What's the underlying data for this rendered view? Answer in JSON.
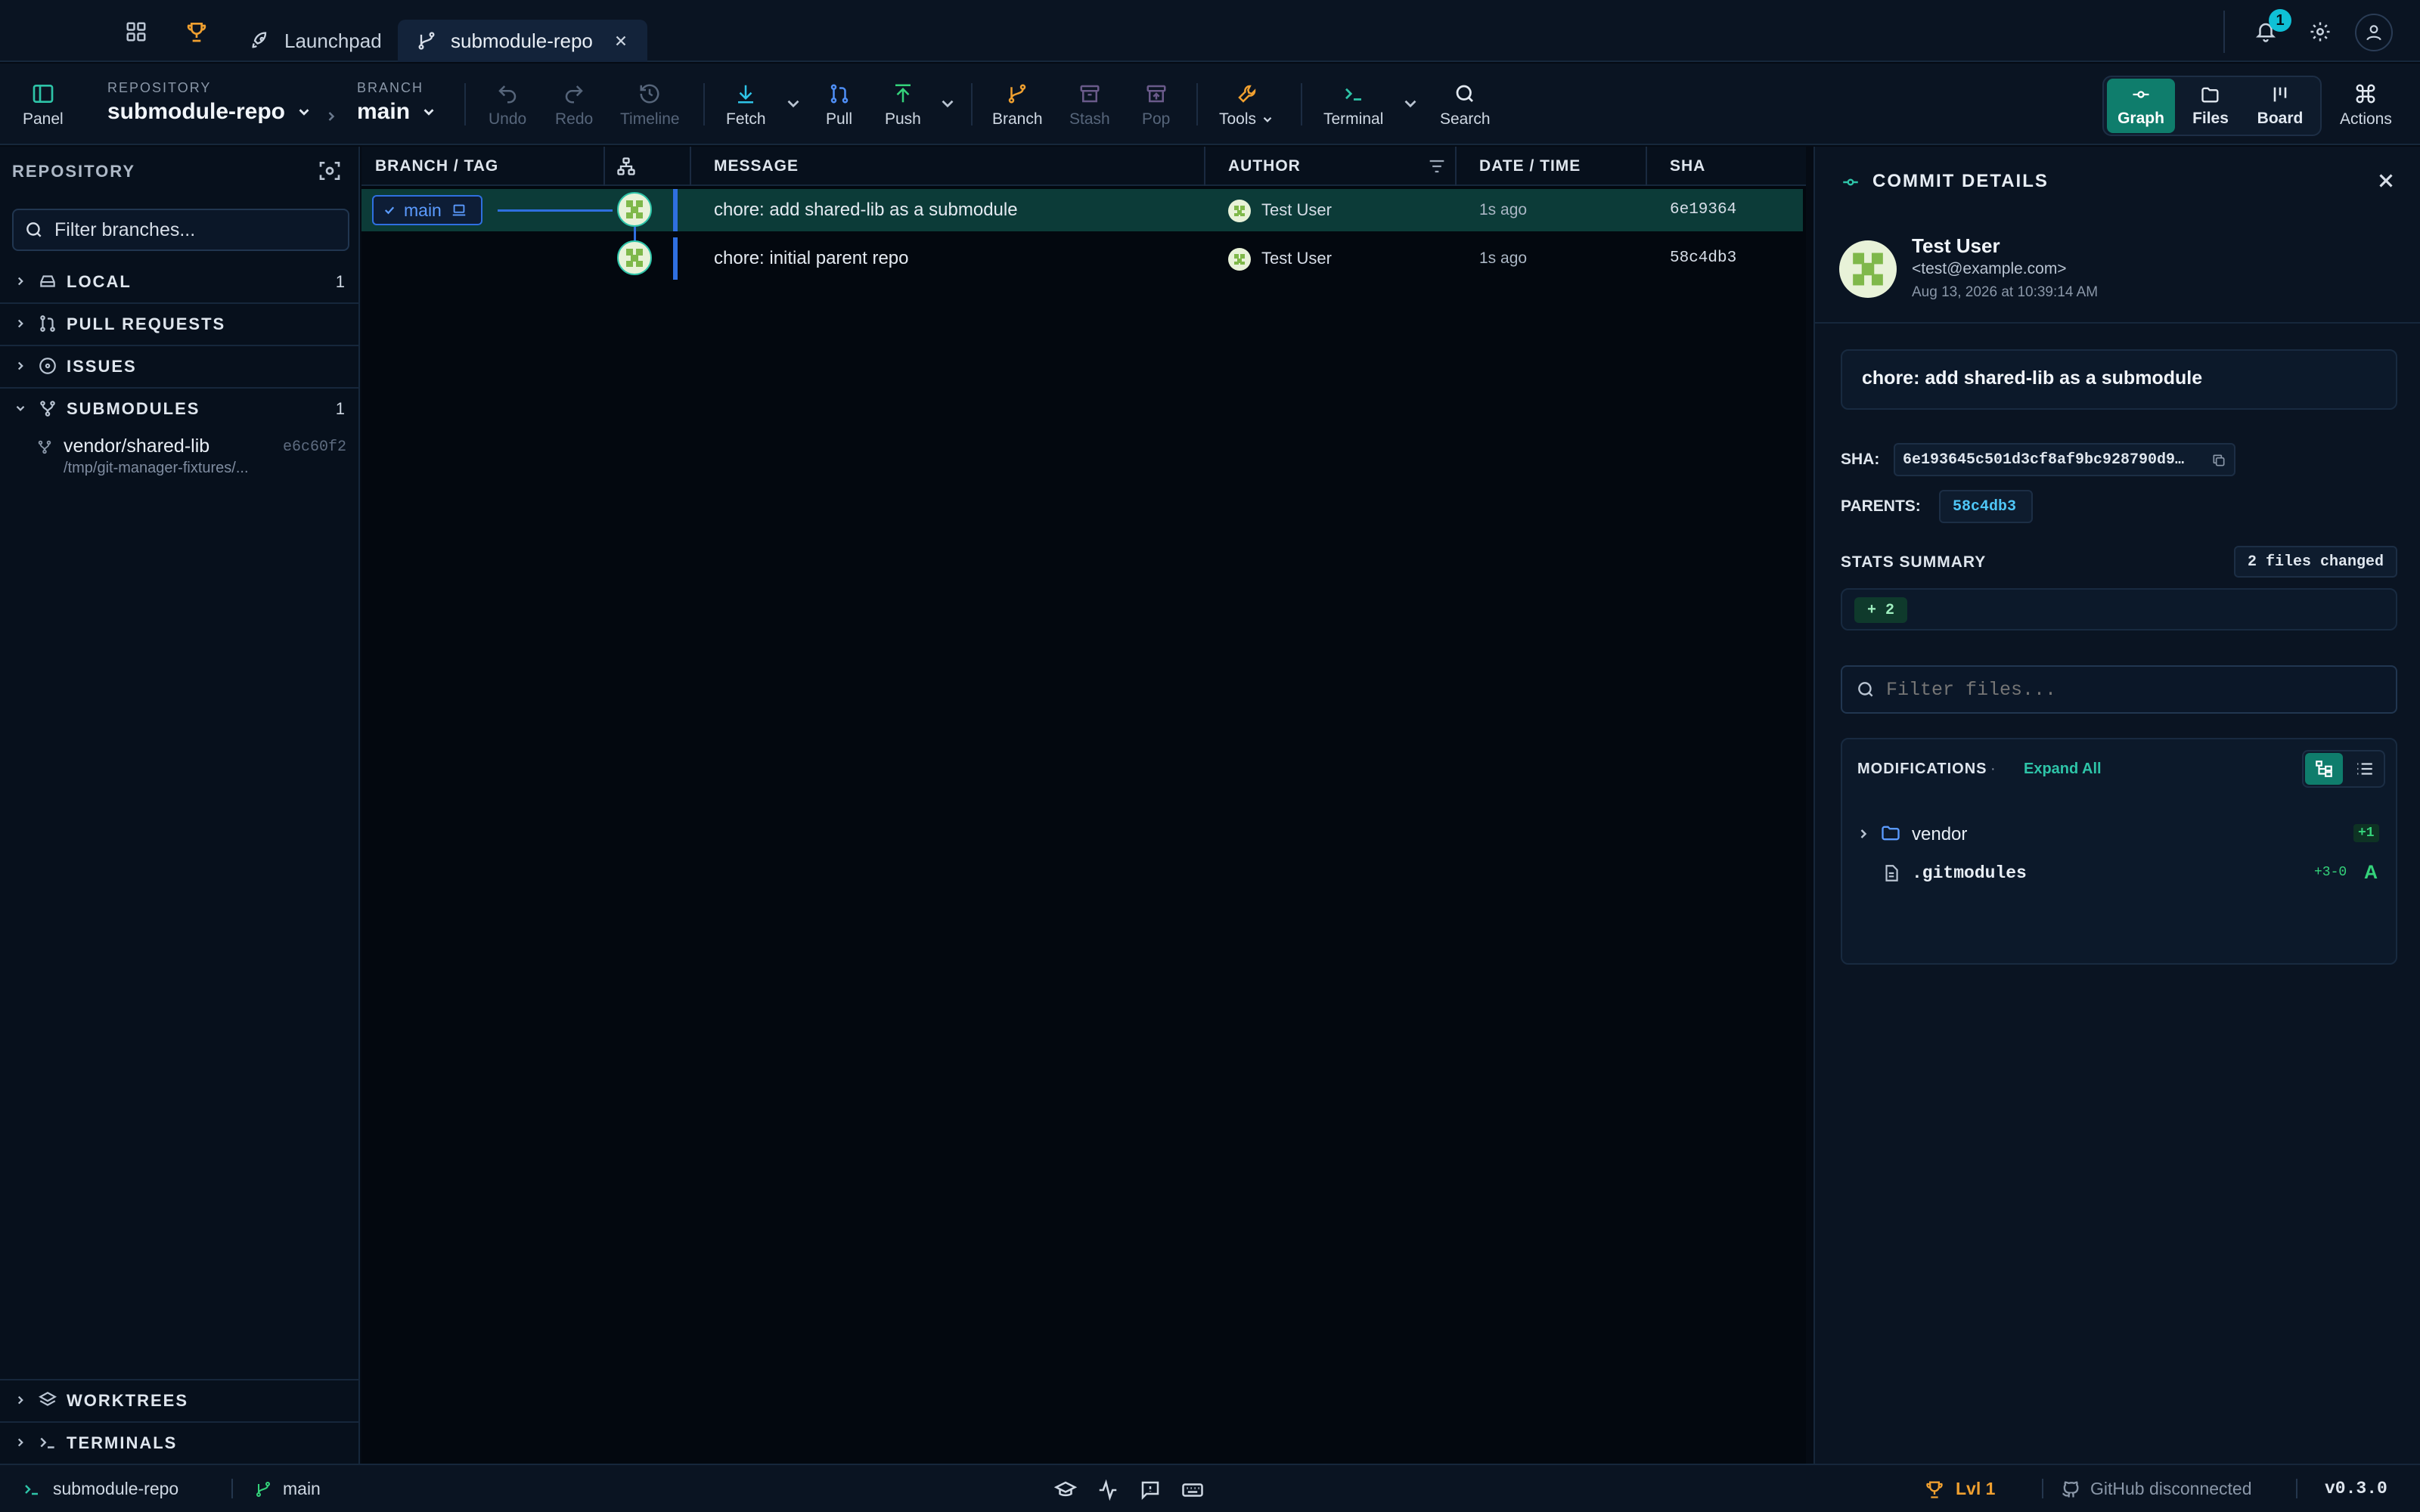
{
  "tabs": [
    {
      "label": "Launchpad",
      "icon": "rocket-icon"
    },
    {
      "label": "submodule-repo",
      "icon": "branch-icon",
      "active": true
    }
  ],
  "notifications": {
    "count": "1"
  },
  "toolbar": {
    "panel_label": "Panel",
    "repository_caption": "REPOSITORY",
    "repository_name": "submodule-repo",
    "branch_caption": "BRANCH",
    "branch_name": "main",
    "undo": "Undo",
    "redo": "Redo",
    "timeline": "Timeline",
    "fetch": "Fetch",
    "pull": "Pull",
    "push": "Push",
    "branch": "Branch",
    "stash": "Stash",
    "pop": "Pop",
    "tools": "Tools",
    "terminal": "Terminal",
    "search": "Search",
    "view_graph": "Graph",
    "view_files": "Files",
    "view_board": "Board",
    "actions": "Actions"
  },
  "sidebar": {
    "title": "REPOSITORY",
    "filter_placeholder": "Filter branches...",
    "sections": {
      "local": {
        "label": "LOCAL",
        "count": "1"
      },
      "pull_requests": {
        "label": "PULL REQUESTS"
      },
      "issues": {
        "label": "ISSUES"
      },
      "submodules": {
        "label": "SUBMODULES",
        "count": "1"
      },
      "worktrees": {
        "label": "WORKTREES"
      },
      "terminals": {
        "label": "TERMINALS"
      }
    },
    "submodule": {
      "name": "vendor/shared-lib",
      "path": "/tmp/git-manager-fixtures/...",
      "sha": "e6c60f2"
    }
  },
  "graph": {
    "headers": {
      "branch_tag": "BRANCH / TAG",
      "message": "MESSAGE",
      "author": "AUTHOR",
      "date_time": "DATE / TIME",
      "sha": "SHA"
    },
    "branch_label": "main",
    "commits": [
      {
        "message": "chore: add shared-lib as a submodule",
        "author": "Test User",
        "time": "1s ago",
        "sha": "6e19364"
      },
      {
        "message": "chore: initial parent repo",
        "author": "Test User",
        "time": "1s ago",
        "sha": "58c4db3"
      }
    ]
  },
  "details": {
    "title": "COMMIT DETAILS",
    "author_name": "Test User",
    "author_email": "<test@example.com>",
    "date": "Aug 13, 2026 at 10:39:14 AM",
    "message": "chore: add shared-lib as a submodule",
    "sha_label": "SHA:",
    "sha_value": "6e193645c501d3cf8af9bc928790d9…",
    "parents_label": "PARENTS:",
    "parent_value": "58c4db3",
    "stats_label": "STATS SUMMARY",
    "files_changed": "2 files changed",
    "additions": "+ 2",
    "filter_files_placeholder": "Filter files...",
    "modifications_label": "MODIFICATIONS",
    "dot": "·",
    "expand_all": "Expand All",
    "files": [
      {
        "name": "vendor",
        "type": "folder",
        "stat": "+1"
      },
      {
        "name": ".gitmodules",
        "type": "file",
        "stat": "+3-0",
        "status": "A"
      }
    ]
  },
  "status": {
    "repo": "submodule-repo",
    "branch": "main",
    "level": "Lvl 1",
    "github": "GitHub disconnected",
    "version": "v0.3.0"
  },
  "colors": {
    "accent": "#0f7d6c",
    "teal": "#2ec4a8",
    "blue": "#3b82f6",
    "orange": "#f0a030",
    "green": "#34d27a"
  }
}
